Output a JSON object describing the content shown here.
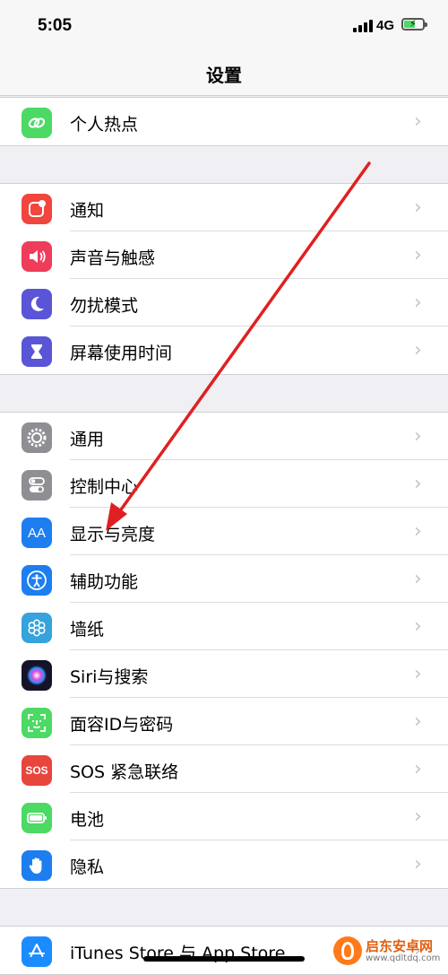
{
  "status": {
    "time": "5:05",
    "network": "4G"
  },
  "nav": {
    "title": "设置"
  },
  "groups": [
    {
      "items": [
        {
          "label": "个人热点",
          "icon": "link-icon",
          "color": "#4cd964"
        }
      ]
    },
    {
      "items": [
        {
          "label": "通知",
          "icon": "notification-icon",
          "color": "#ff3b30"
        },
        {
          "label": "声音与触感",
          "icon": "speaker-icon",
          "color": "#ff2d55"
        },
        {
          "label": "勿扰模式",
          "icon": "moon-icon",
          "color": "#5856d6"
        },
        {
          "label": "屏幕使用时间",
          "icon": "hourglass-icon",
          "color": "#5856d6"
        }
      ]
    },
    {
      "items": [
        {
          "label": "通用",
          "icon": "gear-icon",
          "color": "#8e8e93"
        },
        {
          "label": "控制中心",
          "icon": "toggles-icon",
          "color": "#8e8e93"
        },
        {
          "label": "显示与亮度",
          "icon": "aa-icon",
          "color": "#007aff"
        },
        {
          "label": "辅助功能",
          "icon": "accessibility-icon",
          "color": "#007aff"
        },
        {
          "label": "墙纸",
          "icon": "flower-icon",
          "color": "#34aadc"
        },
        {
          "label": "Siri与搜索",
          "icon": "siri-icon",
          "color": "#1c1c3a"
        },
        {
          "label": "面容ID与密码",
          "icon": "faceid-icon",
          "color": "#4cd964"
        },
        {
          "label": "SOS 紧急联络",
          "icon": "sos-icon",
          "color": "#ff3b30"
        },
        {
          "label": "电池",
          "icon": "battery-icon",
          "color": "#4cd964"
        },
        {
          "label": "隐私",
          "icon": "hand-icon",
          "color": "#007aff"
        }
      ]
    },
    {
      "items": [
        {
          "label": "iTunes Store 与 App Store",
          "icon": "appstore-icon",
          "color": "#1a8cff"
        }
      ]
    }
  ],
  "icon_glyphs": {
    "sos": "SOS",
    "aa": "AA"
  },
  "watermark": {
    "title": "启东安卓网",
    "url": "www.qdltdq.com"
  },
  "annotation": {
    "arrow_color": "#e02020"
  }
}
